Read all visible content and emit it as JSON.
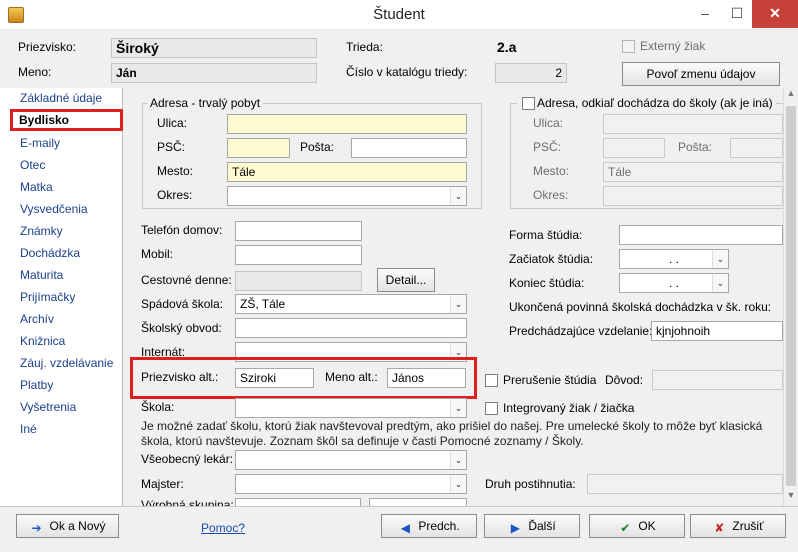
{
  "window": {
    "title": "Študent",
    "min": "–",
    "max": "☐",
    "close": "✕"
  },
  "header": {
    "surname_label": "Priezvisko:",
    "surname": "Široký",
    "name_label": "Meno:",
    "name": "Ján",
    "class_label": "Trieda:",
    "class": "2.a",
    "catalog_label": "Číslo v katalógu triedy:",
    "catalog": "2",
    "external_label": "Externý žiak",
    "allow_button": "Povoľ zmenu údajov"
  },
  "sidebar": {
    "items": [
      {
        "label": "Základné údaje"
      },
      {
        "label": "Bydlisko"
      },
      {
        "label": "E-maily"
      },
      {
        "label": "Otec"
      },
      {
        "label": "Matka"
      },
      {
        "label": "Vysvedčenia"
      },
      {
        "label": "Známky"
      },
      {
        "label": "Dochádzka"
      },
      {
        "label": "Maturita"
      },
      {
        "label": "Prijímačky"
      },
      {
        "label": "Archív"
      },
      {
        "label": "Knižnica"
      },
      {
        "label": "Záuj. vzdelávanie"
      },
      {
        "label": "Platby"
      },
      {
        "label": "Vyšetrenia"
      },
      {
        "label": "Iné"
      }
    ]
  },
  "address": {
    "legend": "Adresa - trvalý pobyt",
    "street_label": "Ulica:",
    "street": "",
    "psc_label": "PSČ:",
    "psc": "",
    "posta_label": "Pošta:",
    "posta": "",
    "city_label": "Mesto:",
    "city": "Tále",
    "district_label": "Okres:",
    "district": ""
  },
  "address2": {
    "legend": "Adresa, odkiaľ dochádza do školy (ak je iná)",
    "street_label": "Ulica:",
    "psc_label": "PSČ:",
    "posta_label": "Pošta:",
    "city_label": "Mesto:",
    "city": "Tále",
    "district_label": "Okres:"
  },
  "left": {
    "phone_label": "Telefón domov:",
    "phone": "",
    "mobile_label": "Mobil:",
    "mobile": "",
    "travel_label": "Cestovné denne:",
    "travel": "",
    "detail_button": "Detail...",
    "school_label": "Spádová škola:",
    "school": "ZŠ, Tále",
    "district_label": "Školský obvod:",
    "district": "",
    "dorm_label": "Internát:",
    "dorm": "",
    "alt_surname_label": "Priezvisko alt.:",
    "alt_surname": "Sziroki",
    "alt_name_label": "Meno alt.:",
    "alt_name": "János",
    "skola_label": "Škola:",
    "skola": "",
    "note": "Je možné zadať školu, ktorú žiak navštevoval predtým, ako prišiel do našej. Pre umelecké školy to môže byť klasická škola, ktorú navštevuje. Zoznam škôl sa definuje v časti Pomocné zoznamy / Školy.",
    "doctor_label": "Všeobecný lekár:",
    "doctor": "",
    "master_label": "Majster:",
    "master": "",
    "group_label": "Výrobná skupina:",
    "group": ""
  },
  "right": {
    "study_form_label": "Forma štúdia:",
    "study_form": "",
    "start_label": "Začiatok štúdia:",
    "start": ". .",
    "end_label": "Koniec štúdia:",
    "end": ". .",
    "compulsory_label": "Ukončená povinná školská dochádzka v šk. roku:",
    "prev_edu_label": "Predchádzajúce vzdelanie:",
    "prev_edu": "kjnjohnoih",
    "interrupt_label": "Prerušenie štúdia",
    "reason_label": "Dôvod:",
    "reason": "",
    "integrated_label": "Integrovaný žiak / žiačka",
    "disability_label": "Druh postihnutia:",
    "disability": ""
  },
  "footer": {
    "ok_new": "Ok a Nový",
    "help": "Pomoc?",
    "prev": "Predch.",
    "next": "Ďalší",
    "ok": "OK",
    "cancel": "Zrušiť"
  }
}
